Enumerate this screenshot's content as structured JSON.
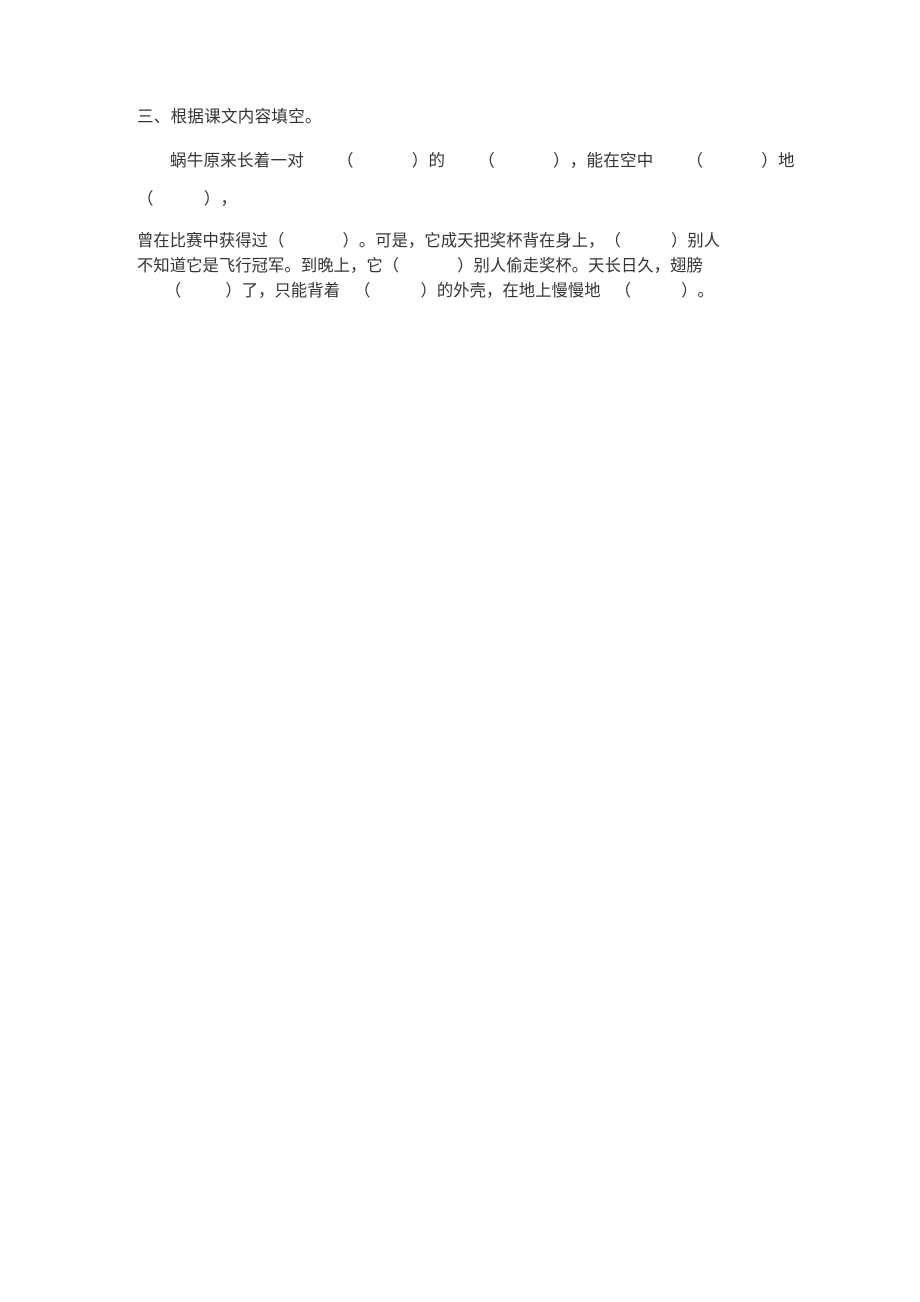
{
  "document": {
    "page_background": "#ffffff",
    "text_color": "#343434",
    "section": {
      "heading": "三、根据课文内容填空。",
      "paragraph_1": {
        "lines": [
          {
            "indent": true,
            "segments": [
              {
                "type": "text",
                "value": "蜗牛原来长着一对"
              },
              {
                "type": "blank",
                "width": "wide"
              },
              {
                "type": "text",
                "value": "的"
              },
              {
                "type": "blank",
                "width": "wide"
              },
              {
                "type": "text",
                "value": "，能在空中"
              },
              {
                "type": "blank",
                "width": "wide"
              },
              {
                "type": "text",
                "value": "地"
              }
            ]
          },
          {
            "indent": false,
            "segments": [
              {
                "type": "blank",
                "width": "mid"
              },
              {
                "type": "text",
                "value": "，"
              }
            ]
          }
        ]
      },
      "paragraph_2": {
        "lines": [
          {
            "indent": false,
            "segments": [
              {
                "type": "text",
                "value": "曾在比赛中获得过"
              },
              {
                "type": "blank",
                "width": "wide"
              },
              {
                "type": "text",
                "value": "。可是，它成天把奖杯背在身上，"
              },
              {
                "type": "blank",
                "width": "mid"
              },
              {
                "type": "text",
                "value": "别人"
              }
            ]
          },
          {
            "indent": false,
            "segments": [
              {
                "type": "text",
                "value": "不知道它是飞行冠军。到晚上，它"
              },
              {
                "type": "blank",
                "width": "wide"
              },
              {
                "type": "text",
                "value": "别人偷走奖杯。天长日久，翅膀"
              }
            ]
          },
          {
            "indent": true,
            "segments": [
              {
                "type": "blank",
                "width": "narrow"
              },
              {
                "type": "text",
                "value": "了，只能背着"
              },
              {
                "type": "blank",
                "width": "mid"
              },
              {
                "type": "text",
                "value": "的外壳，在地上慢慢地"
              },
              {
                "type": "blank",
                "width": "mid"
              },
              {
                "type": "text",
                "value": "。"
              }
            ]
          }
        ]
      }
    },
    "blank_marker": {
      "open": "（",
      "close": "）"
    }
  }
}
